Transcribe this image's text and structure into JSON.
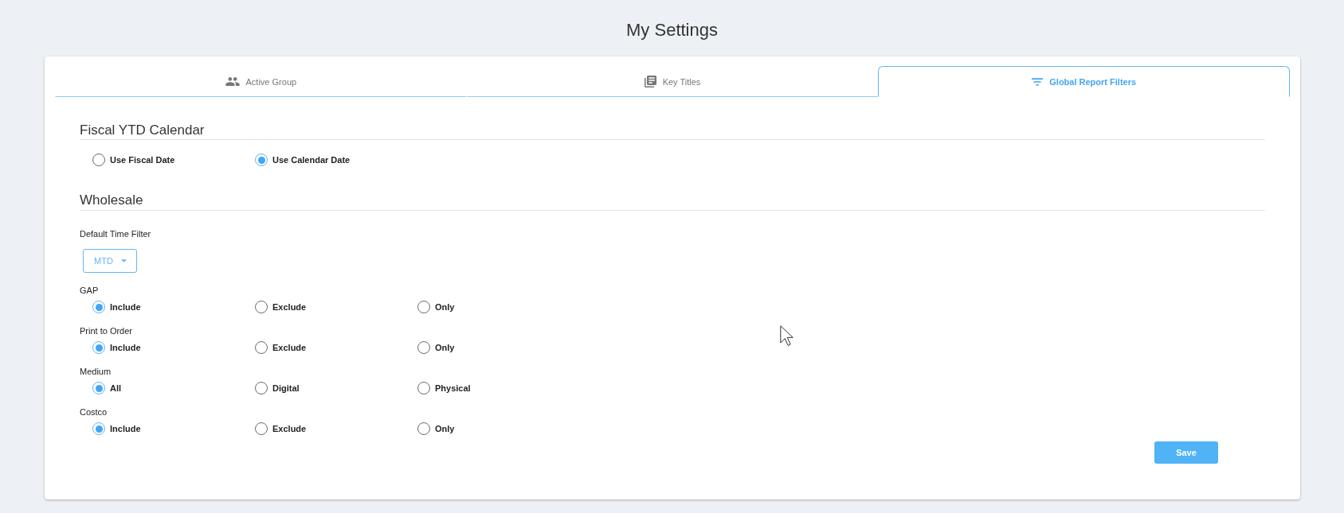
{
  "page": {
    "title": "My Settings"
  },
  "tabs": [
    {
      "label": "Active Group",
      "selected": false
    },
    {
      "label": "Key Titles",
      "selected": false
    },
    {
      "label": "Global Report Filters",
      "selected": true
    }
  ],
  "fiscal_ytd_calendar": {
    "title": "Fiscal YTD Calendar",
    "options": [
      {
        "label": "Use Fiscal Date",
        "selected": false
      },
      {
        "label": "Use Calendar Date",
        "selected": true
      }
    ]
  },
  "wholesale": {
    "title": "Wholesale",
    "time_filter": {
      "label": "Default Time Filter",
      "value": "MTD"
    },
    "groups": [
      {
        "label": "GAP",
        "options": [
          {
            "label": "Include",
            "selected": true
          },
          {
            "label": "Exclude",
            "selected": false
          },
          {
            "label": "Only",
            "selected": false
          }
        ]
      },
      {
        "label": "Print to Order",
        "options": [
          {
            "label": "Include",
            "selected": true
          },
          {
            "label": "Exclude",
            "selected": false
          },
          {
            "label": "Only",
            "selected": false
          }
        ]
      },
      {
        "label": "Medium",
        "options": [
          {
            "label": "All",
            "selected": true
          },
          {
            "label": "Digital",
            "selected": false
          },
          {
            "label": "Physical",
            "selected": false
          }
        ]
      },
      {
        "label": "Costco",
        "options": [
          {
            "label": "Include",
            "selected": true
          },
          {
            "label": "Exclude",
            "selected": false
          },
          {
            "label": "Only",
            "selected": false
          }
        ]
      }
    ]
  },
  "save_button": {
    "label": "Save"
  }
}
